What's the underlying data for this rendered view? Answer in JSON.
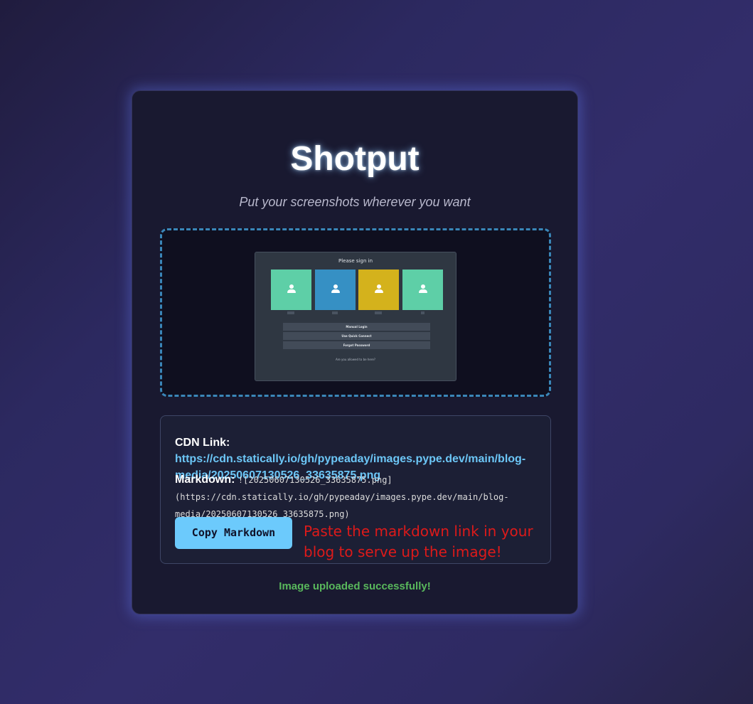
{
  "app": {
    "title": "Shotput",
    "subtitle": "Put your screenshots wherever you want"
  },
  "preview": {
    "title": "Please sign in",
    "tile_colors": [
      "#5ecfa7",
      "#3690c4",
      "#d4b21c",
      "#5ecfa7"
    ],
    "buttons": [
      "Manual Login",
      "Use Quick Connect",
      "Forgot Password"
    ],
    "footer": "Are you allowed to be here?"
  },
  "result": {
    "cdn_label": "CDN Link:",
    "cdn_url": "https://cdn.statically.io/gh/pypeaday/images.pype.dev/main/blog-media/20250607130526_33635875.png",
    "markdown_label": "Markdown:",
    "markdown_value": "![20250607130526_33635875.png](https://cdn.statically.io/gh/pypeaday/images.pype.dev/main/blog-media/20250607130526_33635875.png)",
    "copy_button_label": "Copy Markdown",
    "hint": "Paste the markdown link in your blog to serve up the image!"
  },
  "status": "Image uploaded successfully!"
}
